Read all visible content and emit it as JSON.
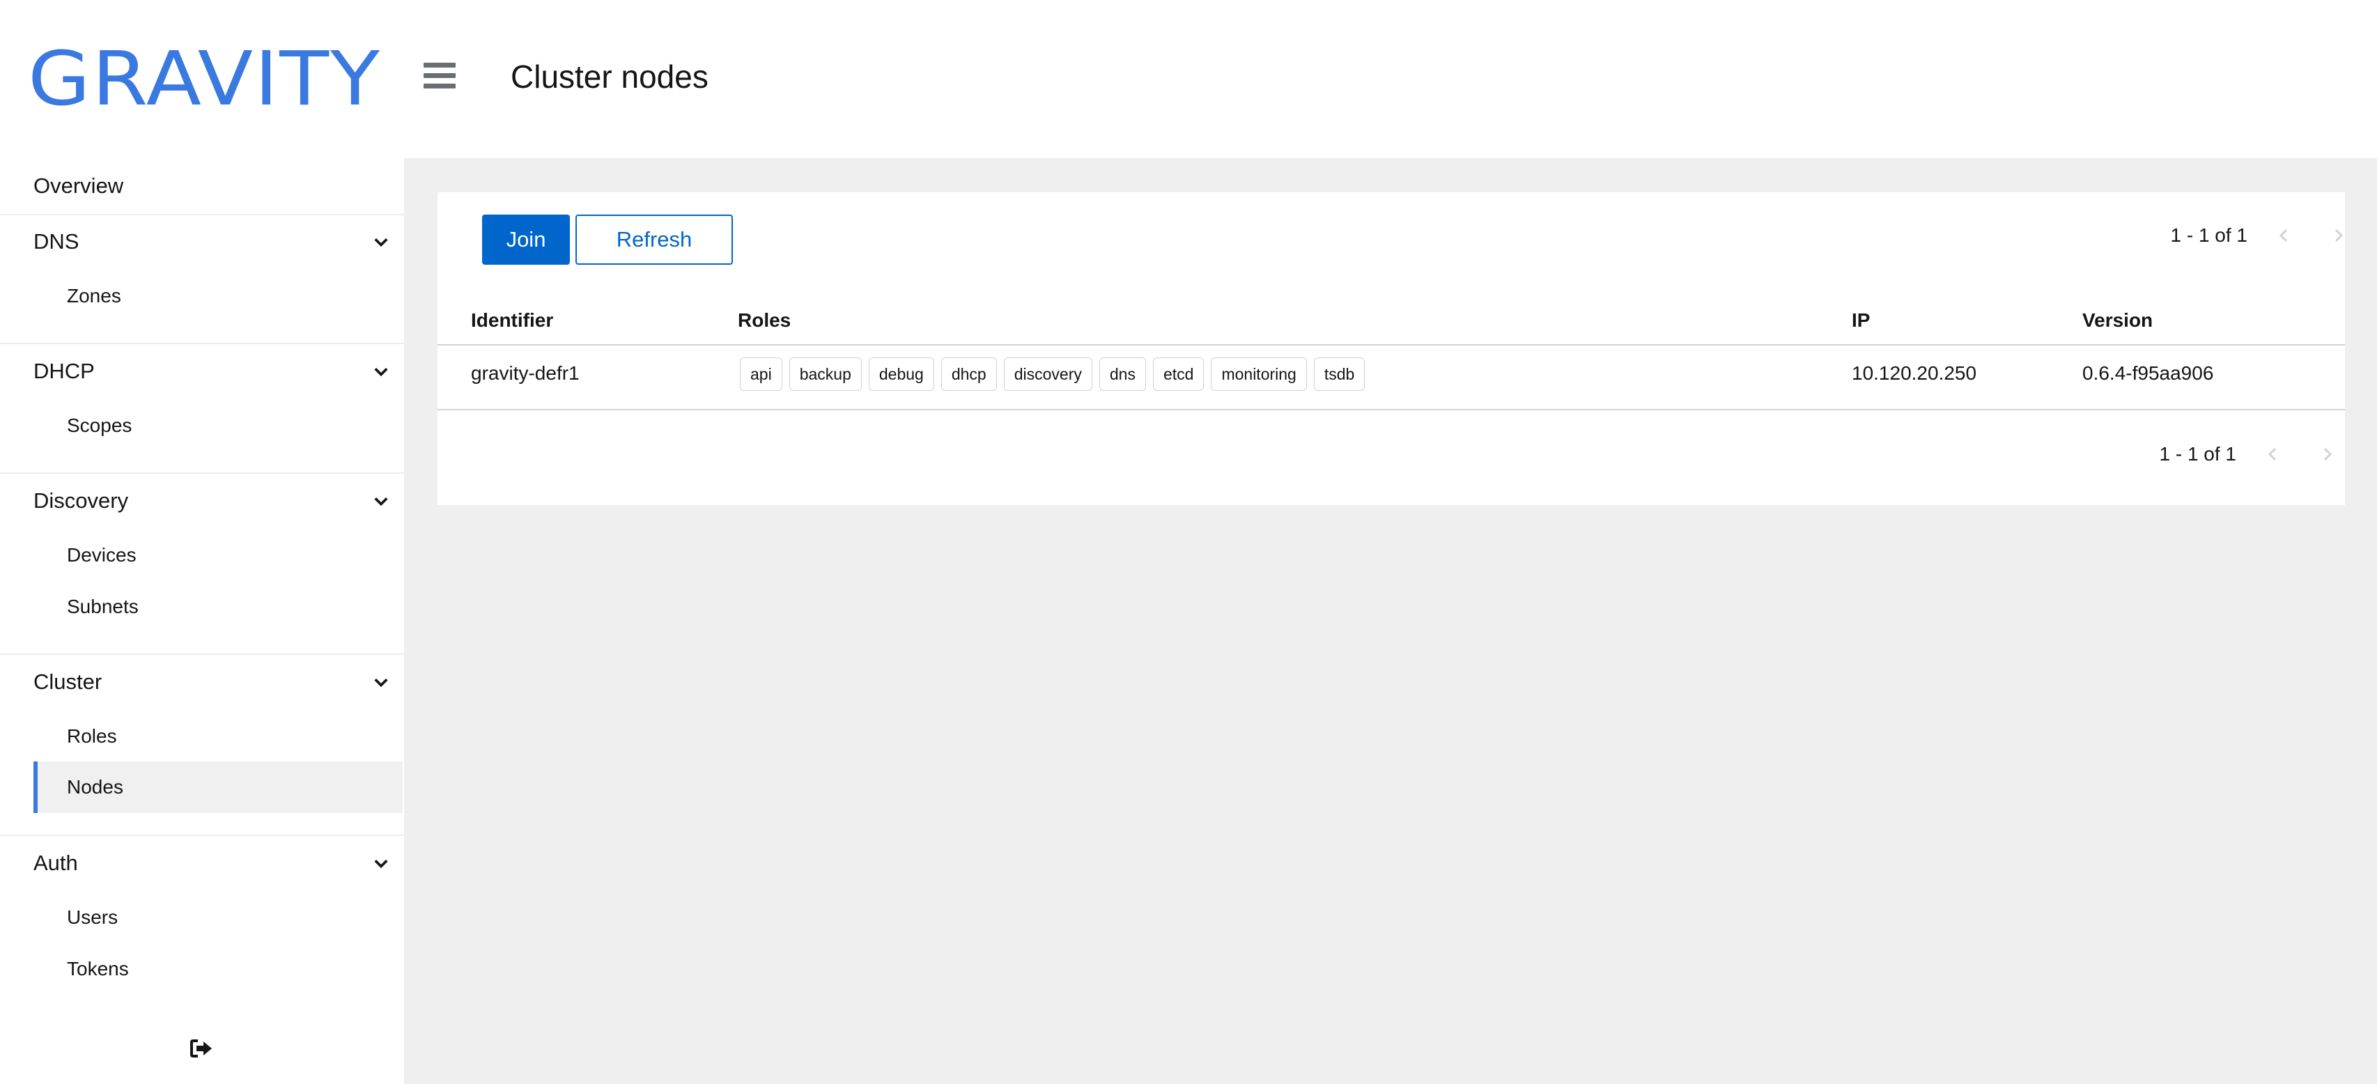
{
  "app": {
    "logo_text": "GRAVITY",
    "page_title": "Cluster nodes"
  },
  "colors": {
    "brand": "#3a79e0",
    "primary": "#0066cc",
    "main_bg": "#efefef",
    "active_bg": "#f0f0f0"
  },
  "sidebar": {
    "overview": "Overview",
    "groups": [
      {
        "title": "DNS",
        "items": [
          "Zones"
        ]
      },
      {
        "title": "DHCP",
        "items": [
          "Scopes"
        ]
      },
      {
        "title": "Discovery",
        "items": [
          "Devices",
          "Subnets"
        ]
      },
      {
        "title": "Cluster",
        "items": [
          "Roles",
          "Nodes"
        ],
        "active_item": "Nodes"
      },
      {
        "title": "Auth",
        "items": [
          "Users",
          "Tokens"
        ]
      }
    ],
    "icons": {
      "group_toggle": "chevron-down-icon",
      "logout": "logout-icon",
      "menu": "hamburger-icon"
    }
  },
  "toolbar": {
    "join_label": "Join",
    "refresh_label": "Refresh"
  },
  "pagination": {
    "top_text": "1 - 1 of 1",
    "bottom_text": "1 - 1 of 1"
  },
  "table": {
    "columns": [
      "Identifier",
      "Roles",
      "IP",
      "Version"
    ],
    "rows": [
      {
        "identifier": "gravity-defr1",
        "roles": [
          "api",
          "backup",
          "debug",
          "dhcp",
          "discovery",
          "dns",
          "etcd",
          "monitoring",
          "tsdb"
        ],
        "ip": "10.120.20.250",
        "version": "0.6.4-f95aa906"
      }
    ]
  }
}
